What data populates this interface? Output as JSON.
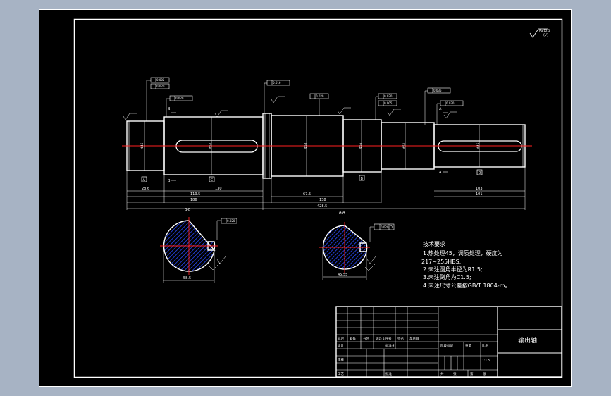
{
  "drawing": {
    "part_name": "输出轴",
    "title_block": {
      "label_1": "标记",
      "label_2": "处数",
      "label_3": "分区",
      "label_4": "更改文件号",
      "label_5": "签名",
      "label_6": "年月日",
      "label_design": "设计",
      "label_standardize": "标准化",
      "label_stage_mark": "阶段标记",
      "label_weight": "重量",
      "label_scale": "比例",
      "label_review": "审核",
      "label_process": "工艺",
      "label_approve": "批准",
      "label_sheet_total": "共",
      "label_sheet_no": "张",
      "label_sheet_1": "第",
      "label_sheet_2": "张",
      "scale_value": "1:1.5"
    },
    "tech_requirements": {
      "title": "技术要求",
      "lines": [
        "1.热处理45，调质处理，硬度为",
        "217~255HBS;",
        "2.未注圆角半径为R1.5;",
        "3.未注倒角为C1.5;",
        "4.未注尺寸公差按GB/T 1804-m。"
      ]
    },
    "section_labels": [
      "B-B",
      "A-A"
    ],
    "datum_labels": [
      "A",
      "B",
      "C",
      "D"
    ],
    "dimensions": {
      "d1": "28.6",
      "d2": "119.5",
      "d3": "130",
      "d4": "186",
      "d5": "67.5",
      "d6": "138",
      "d7": "103",
      "d8": "101",
      "d9": "428.5",
      "d10": "58.5",
      "d11": "45.55"
    },
    "tolerances": {
      "t1": "0.005",
      "t2": "0.020",
      "t3": "0.020",
      "t4": "0.016",
      "t5": "0.020",
      "t6": "0.020",
      "t7": "0.005",
      "t8": "0.036",
      "t9": "0.030"
    },
    "roughness_top": "Ra 12.5"
  },
  "colors": {
    "background": "#a7b3c4",
    "paper": "#000000",
    "lines": "#ffffff",
    "centerline": "#ff2020",
    "hatch": "#2a4bff"
  }
}
